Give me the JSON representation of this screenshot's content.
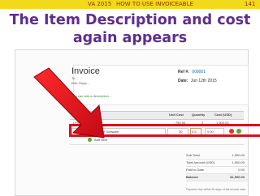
{
  "ribbon": {
    "left": "VA 2015",
    "center": "HOW TO USE INVOICEABLE",
    "right": "141"
  },
  "slide": {
    "title_line1": "The Item Description and cost",
    "title_line2": "again appears"
  },
  "invoice": {
    "title": "Invoice",
    "sub1": "To:",
    "sub2": "Deli: Ropp...",
    "link": "You can add a description...",
    "ref_label": "Ref #:",
    "ref_value": "000001",
    "date_label": "Date:",
    "date_value": "Jun 12th 2015"
  },
  "table": {
    "headers": {
      "item": "Item",
      "desc": "",
      "unit_cost": "Unit Cost",
      "qty": "Quantity",
      "cost": "Cost (USD)"
    },
    "rows": [
      {
        "item": "LP1",
        "desc": "Lab",
        "unit_cost": "750.00",
        "qty": "2",
        "cost": "1,500.00"
      },
      {
        "item": "Stat006",
        "desc": "Service Software",
        "unit_cost": "30",
        "qty": "0.5",
        "cost": "0.00"
      }
    ],
    "add_label": "Add Item"
  },
  "totals": [
    {
      "label": "Sub Total",
      "value": "1,500.00"
    },
    {
      "label": "Total Amount (USD)",
      "value": "1,500.00"
    },
    {
      "label": "Paid to Date",
      "value": "0.00"
    },
    {
      "label": "Balance",
      "value": "$1,500.00"
    }
  ],
  "footnote": "Payment due within 30 days of the invoice date.",
  "colors": {
    "accent": "#d6121f",
    "title": "#5e2e8e",
    "ribbon": "#f3d91c"
  }
}
